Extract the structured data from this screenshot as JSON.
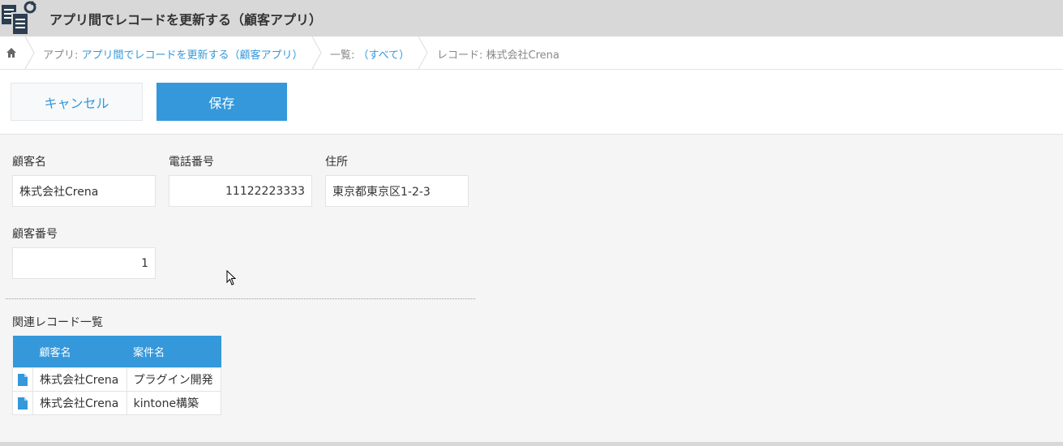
{
  "app": {
    "title": "アプリ間でレコードを更新する（顧客アプリ）"
  },
  "breadcrumb": {
    "app_prefix": "アプリ:",
    "app_name": "アプリ間でレコードを更新する（顧客アプリ）",
    "list_prefix": "一覧:",
    "list_name": "（すべて）",
    "record_label": "レコード: 株式会社Crena"
  },
  "toolbar": {
    "cancel_label": "キャンセル",
    "save_label": "保存"
  },
  "form": {
    "customer_name": {
      "label": "顧客名",
      "value": "株式会社Crena"
    },
    "phone": {
      "label": "電話番号",
      "value": "11122223333"
    },
    "address": {
      "label": "住所",
      "value": "東京都東京区1-2-3"
    },
    "customer_no": {
      "label": "顧客番号",
      "value": "1"
    }
  },
  "related": {
    "title": "関連レコード一覧",
    "columns": [
      "顧客名",
      "案件名"
    ],
    "rows": [
      [
        "株式会社Crena",
        "プラグイン開発"
      ],
      [
        "株式会社Crena",
        "kintone構築"
      ]
    ]
  },
  "colors": {
    "accent": "#3498db",
    "header_bg": "#d8d8d8",
    "page_bg": "#f5f5f5"
  }
}
